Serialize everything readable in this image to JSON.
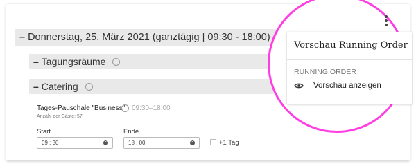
{
  "day": {
    "label": "Donnerstag, 25. März 2021 (ganztägig | 09:30 - 18:00)"
  },
  "sections": {
    "meeting_rooms": "Tagungsräume",
    "catering": "Catering"
  },
  "item": {
    "title": "Tages-Pauschale \"Business\"",
    "time": "09:30–18:00",
    "guests": "Anzahl der Gäste: 57"
  },
  "fields": {
    "start_label": "Start",
    "start_value": "09 : 30",
    "end_label": "Ende",
    "end_value": "18 : 00",
    "plus_day_label": "+1 Tag"
  },
  "menu": {
    "title": "Vorschau Running Order",
    "section": "RUNNING ORDER",
    "preview_item": "Vorschau anzeigen"
  },
  "colors": {
    "highlight_ring": "#ff3de3",
    "row_bg": "#e9e9e9"
  },
  "icons": {
    "menu_button": "kebab-icon",
    "preview": "eye-icon",
    "time": "clock-icon"
  }
}
